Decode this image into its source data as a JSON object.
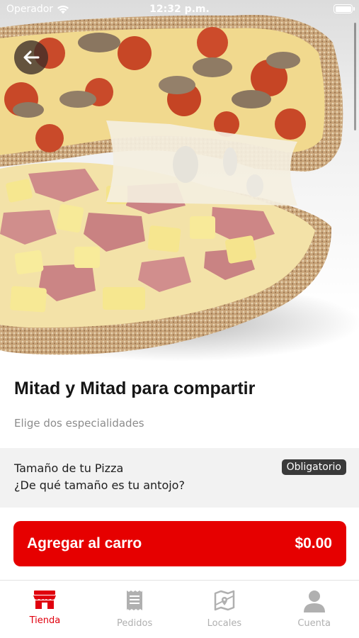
{
  "status_bar": {
    "carrier": "Operador",
    "time": "12:32 p.m."
  },
  "hero": {
    "image": "half-and-half-pizza-photo"
  },
  "product": {
    "title": "Mitad y Mitad para compartir",
    "subtitle": "Elige dos especialidades"
  },
  "option": {
    "title": "Tamaño de tu Pizza",
    "question": "¿De qué tamaño es tu antojo?",
    "badge": "Obligatorio"
  },
  "cart": {
    "label": "Agregar al carro",
    "price": "$0.00"
  },
  "tabs": [
    {
      "label": "Tienda",
      "icon": "store-icon",
      "active": true
    },
    {
      "label": "Pedidos",
      "icon": "receipt-icon",
      "active": false
    },
    {
      "label": "Locales",
      "icon": "map-icon",
      "active": false
    },
    {
      "label": "Cuenta",
      "icon": "user-icon",
      "active": false
    }
  ],
  "colors": {
    "accent": "#e60000",
    "tab_active": "#e0000e",
    "tab_inactive": "#b0b0b0",
    "badge_bg": "#3a3a3a",
    "section_bg": "#f2f2f2"
  }
}
